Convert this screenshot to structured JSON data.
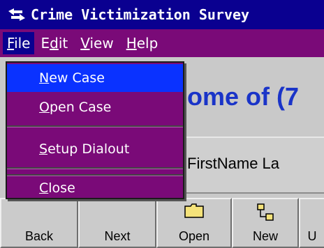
{
  "window": {
    "title": "Crime Victimization Survey"
  },
  "menubar": {
    "file": {
      "mnemonic": "F",
      "rest": "ile"
    },
    "edit": {
      "pre": "E",
      "mnemonic": "d",
      "rest": "it"
    },
    "view": {
      "mnemonic": "V",
      "rest": "iew"
    },
    "help": {
      "mnemonic": "H",
      "rest": "elp"
    }
  },
  "file_menu": {
    "items": [
      {
        "mnemonic": "N",
        "rest": "ew Case"
      },
      {
        "mnemonic": "O",
        "rest": "pen Case"
      },
      {
        "mnemonic": "S",
        "rest": "etup Dialout"
      },
      {
        "mnemonic": "C",
        "rest": "lose"
      }
    ]
  },
  "main": {
    "heading": "ome of (7",
    "name_label": "FirstName La"
  },
  "toolbar": {
    "back": "Back",
    "next": "Next",
    "open": "Open",
    "new": "New",
    "more": "U"
  },
  "colors": {
    "titlebar": "#0a0090",
    "menubar": "#7a0a78",
    "highlight": "#0a32ff",
    "heading": "#1a34c8"
  }
}
